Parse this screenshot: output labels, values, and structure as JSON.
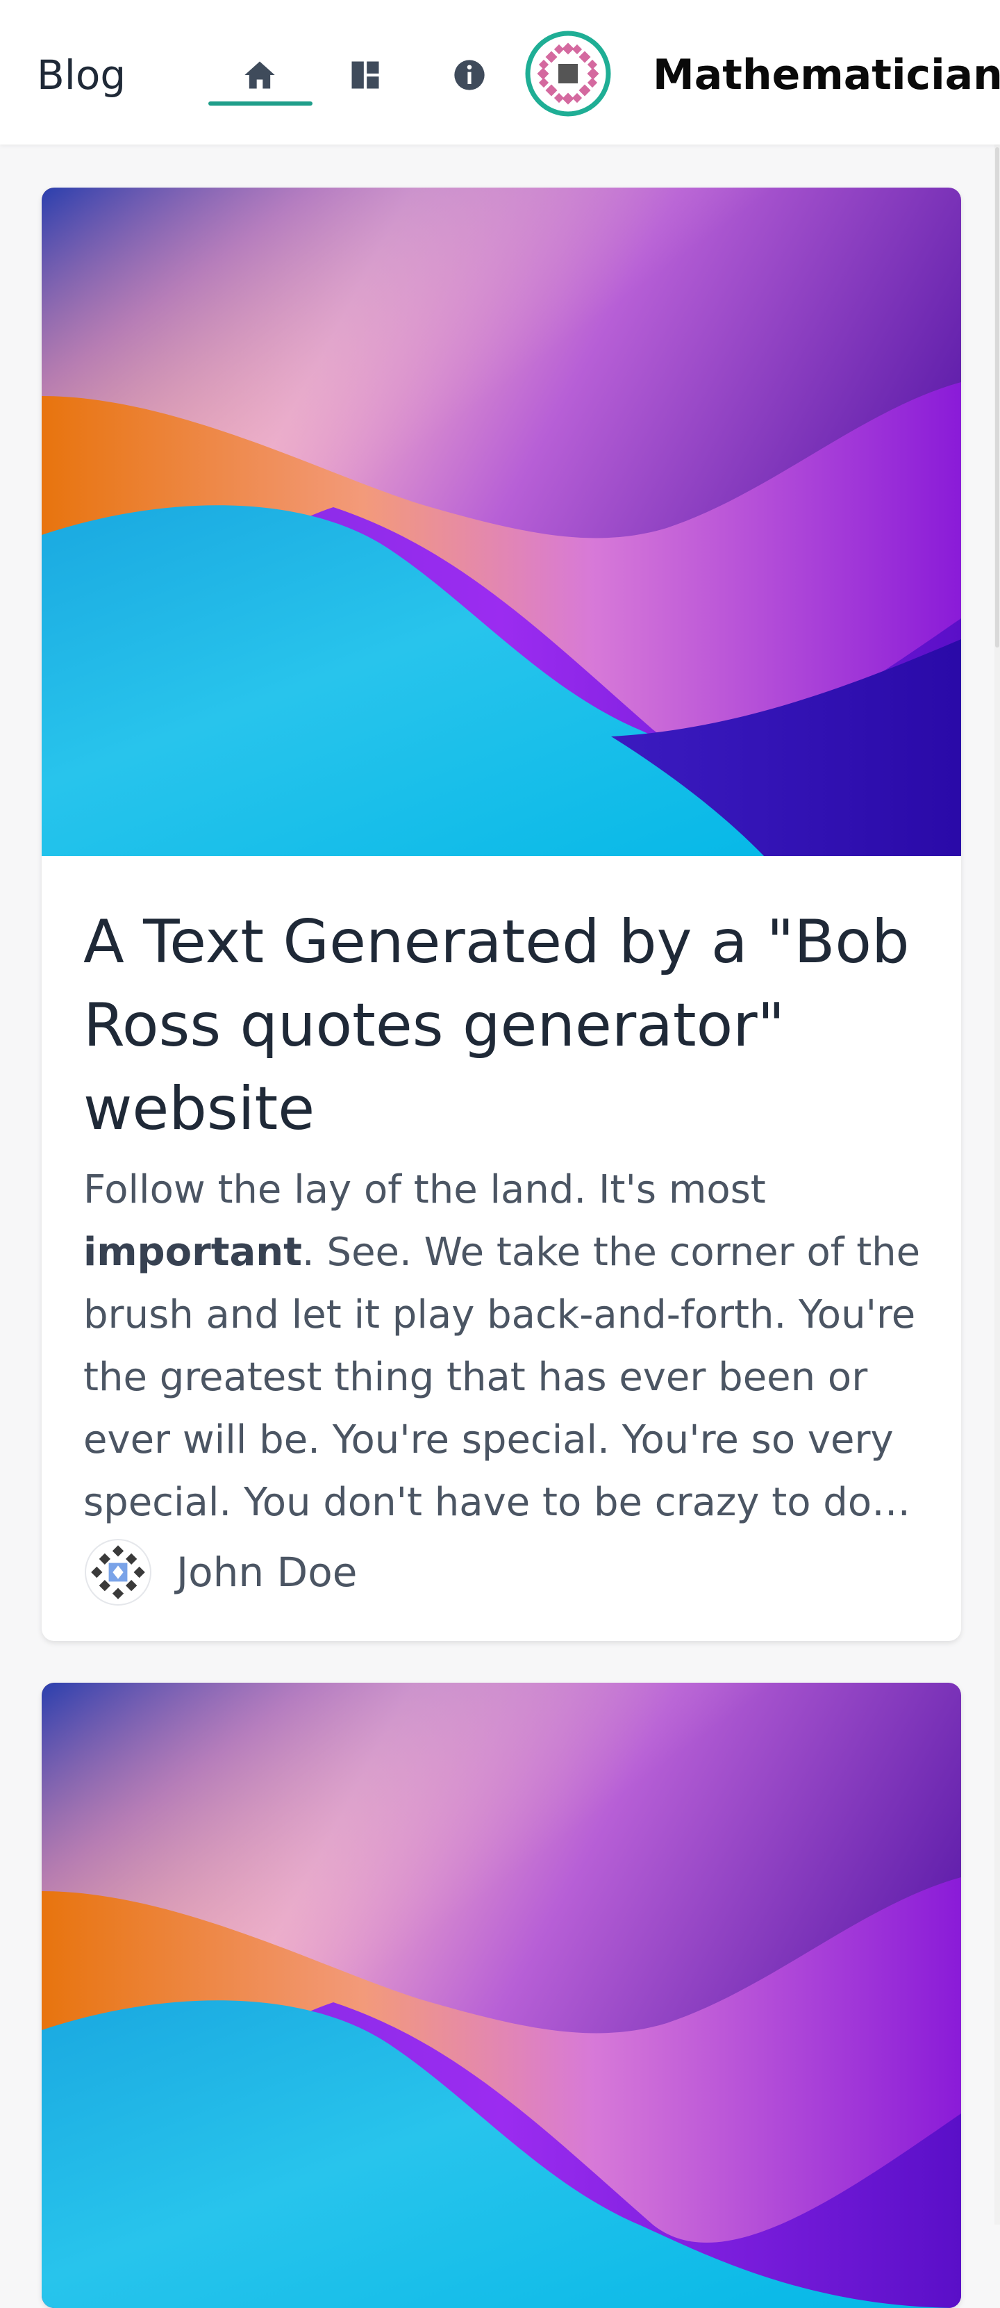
{
  "navbar": {
    "blog_label": "Blog",
    "brand": "Mathematician",
    "home_icon": "home-icon",
    "dashboard_icon": "dashboard-icon",
    "info_icon": "info-icon",
    "accent_color": "#1f9e8a"
  },
  "posts": [
    {
      "title": "A Text Generated by a \"Bob Ross quotes generator\" website",
      "excerpt_lead": "Follow the lay of the land. It's most ",
      "excerpt_bold": "important",
      "excerpt_rest": ". See. We take the corner of the brush and let it play back-and-forth. You're the greatest thing that has ever been or ever will be. You're special. You're so very special. You don't have to be crazy to do…",
      "author": "John Doe"
    },
    {
      "title": "",
      "author": ""
    }
  ]
}
